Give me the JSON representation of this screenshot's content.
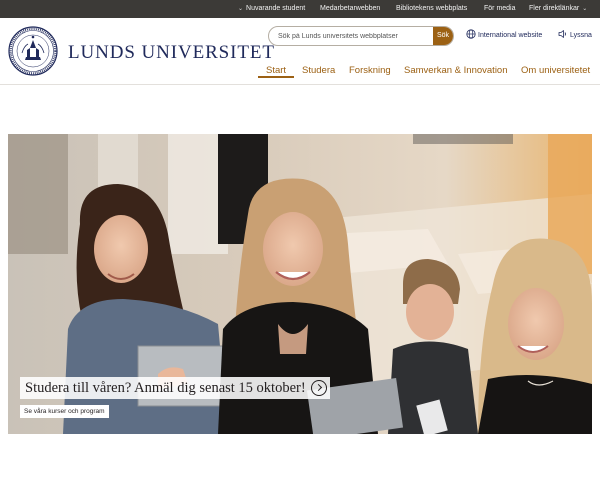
{
  "topbar": {
    "links": [
      {
        "label": "Nuvarande student",
        "chevron": "down"
      },
      {
        "label": "Medarbetarwebben"
      },
      {
        "label": "Bibliotekens webbplats"
      },
      {
        "label": "För media"
      },
      {
        "label": "Fler direktlänkar",
        "chevron": "down"
      }
    ]
  },
  "header": {
    "logo_text": "Lunds universitet",
    "seal_icon": "university-seal-icon",
    "search": {
      "placeholder": "Sök på Lunds universitets webbplatser",
      "value": "",
      "button_label": "Sök"
    },
    "international_label": "International website",
    "listen_label": "Lyssna",
    "nav": [
      {
        "label": "Start",
        "active": true
      },
      {
        "label": "Studera"
      },
      {
        "label": "Forskning"
      },
      {
        "label": "Samverkan & Innovation"
      },
      {
        "label": "Om universitetet"
      }
    ]
  },
  "hero": {
    "headline": "Studera till våren? Anmäl dig senast 15 oktober!",
    "cta_label": "Se våra kurser och program",
    "image_alt": "four students"
  },
  "colors": {
    "topbar_bg": "#3c3a37",
    "brand_blue": "#202a5b",
    "accent_bronze": "#9c6114",
    "search_button_bg": "#9c6114"
  }
}
